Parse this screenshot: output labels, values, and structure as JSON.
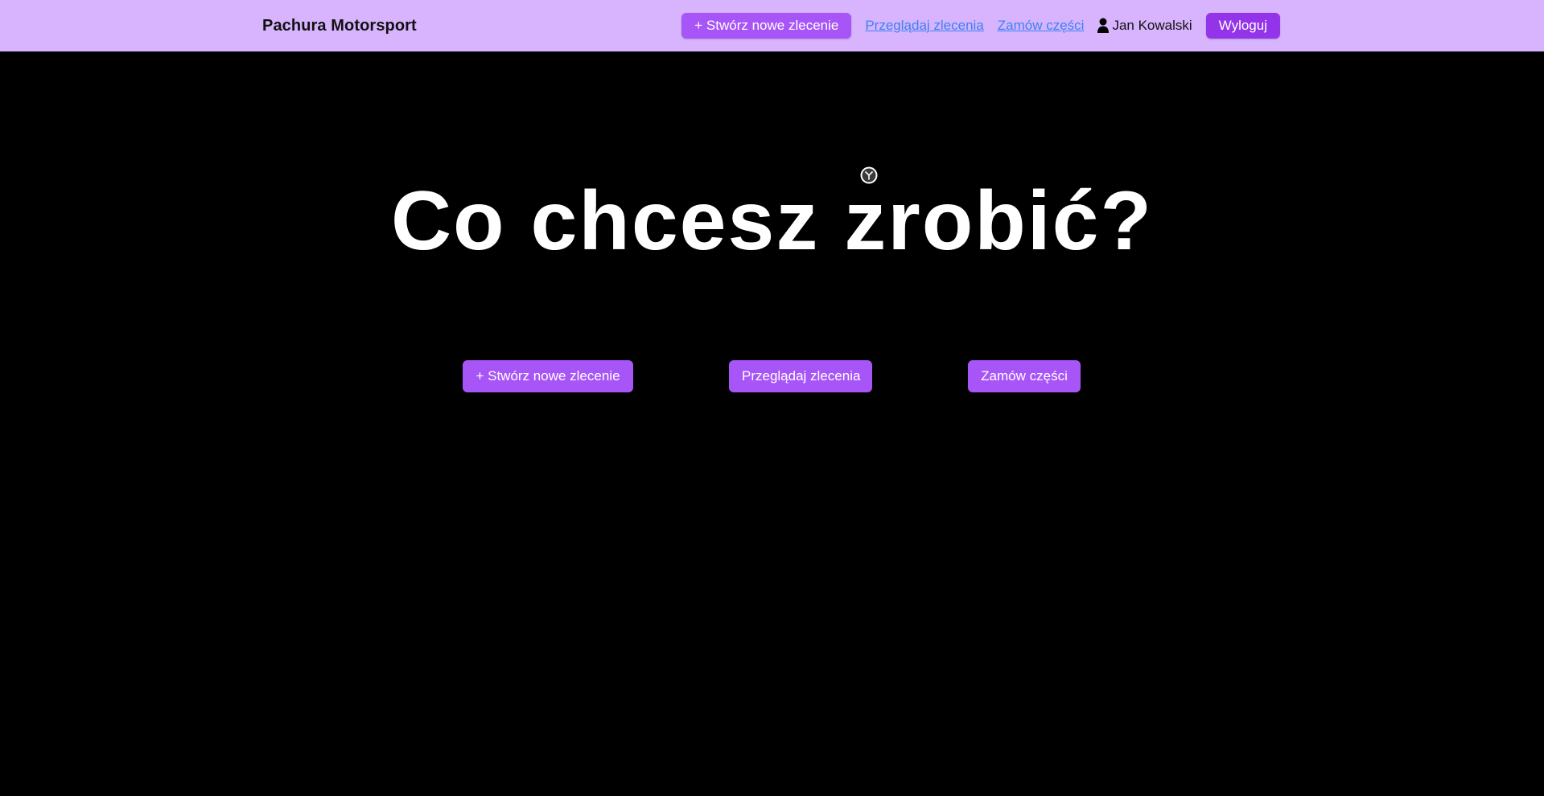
{
  "navbar": {
    "brand": "Pachura Motorsport",
    "create_button": "+ Stwórz nowe zlecenie",
    "browse_link": "Przeglądaj zlecenia",
    "order_link": "Zamów części",
    "user_name": "Jan Kowalski",
    "logout_button": "Wyloguj"
  },
  "main": {
    "headline": "Co chcesz zrobić?",
    "actions": [
      {
        "label": "+ Stwórz nowe zlecenie"
      },
      {
        "label": "Przeglądaj zlecenia"
      },
      {
        "label": "Zamów części"
      }
    ]
  },
  "icons": {
    "user": "user-icon",
    "cursor": "cursor-icon"
  },
  "colors": {
    "navbar_background": "#d8b4fe",
    "page_background": "#000000",
    "button": "#a855f7",
    "logout_button": "#9333ea",
    "link": "#3b82f6",
    "headline": "#ffffff"
  }
}
